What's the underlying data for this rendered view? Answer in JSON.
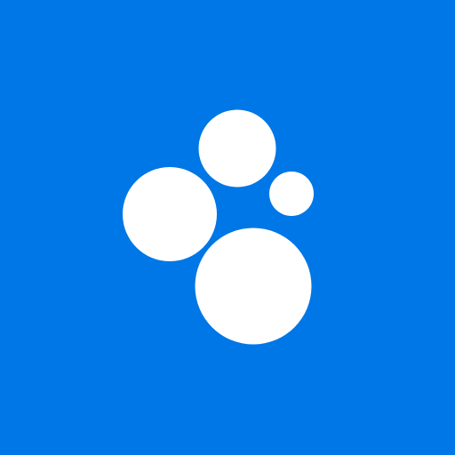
{
  "icon": {
    "semantic": "bubbles-logo-icon",
    "background_color": "#0077E6",
    "foreground_color": "#FFFFFF"
  }
}
